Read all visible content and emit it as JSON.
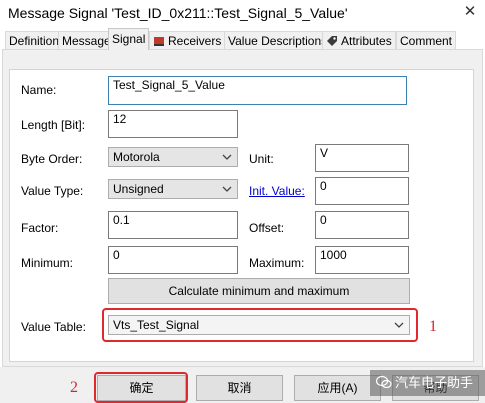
{
  "window": {
    "title": "Message Signal 'Test_ID_0x211::Test_Signal_5_Value'",
    "close_glyph": "✕"
  },
  "tabs": [
    {
      "label": "Definition",
      "active": false
    },
    {
      "label": "Message",
      "active": false
    },
    {
      "label": "Signal",
      "active": true
    },
    {
      "label": "Receivers",
      "active": false,
      "icon": "receivers-icon"
    },
    {
      "label": "Value Descriptions",
      "active": false
    },
    {
      "label": "Attributes",
      "active": false,
      "icon": "attributes-icon"
    },
    {
      "label": "Comment",
      "active": false
    }
  ],
  "form": {
    "name": {
      "label": "Name:",
      "value": "Test_Signal_5_Value"
    },
    "length": {
      "label": "Length [Bit]:",
      "value": "12"
    },
    "byte_order": {
      "label": "Byte Order:",
      "value": "Motorola"
    },
    "unit": {
      "label": "Unit:",
      "value": "V"
    },
    "value_type": {
      "label": "Value Type:",
      "value": "Unsigned"
    },
    "init_value": {
      "label": "Init. Value:",
      "value": "0"
    },
    "factor": {
      "label": "Factor:",
      "value": "0.1"
    },
    "offset": {
      "label": "Offset:",
      "value": "0"
    },
    "minimum": {
      "label": "Minimum:",
      "value": "0"
    },
    "maximum": {
      "label": "Maximum:",
      "value": "1000"
    },
    "calc_button": "Calculate minimum and maximum",
    "value_table": {
      "label": "Value Table:",
      "value": "Vts_Test_Signal"
    }
  },
  "annotations": {
    "marker_1": "1",
    "marker_2": "2",
    "highlight_color": "#e0282e"
  },
  "footer": {
    "ok": "确定",
    "cancel": "取消",
    "apply": "应用(A)",
    "help": "帮助"
  },
  "watermark": "汽车电子助手",
  "colors": {
    "link": "#0000cc",
    "panel_bg": "#f0f0f0"
  }
}
